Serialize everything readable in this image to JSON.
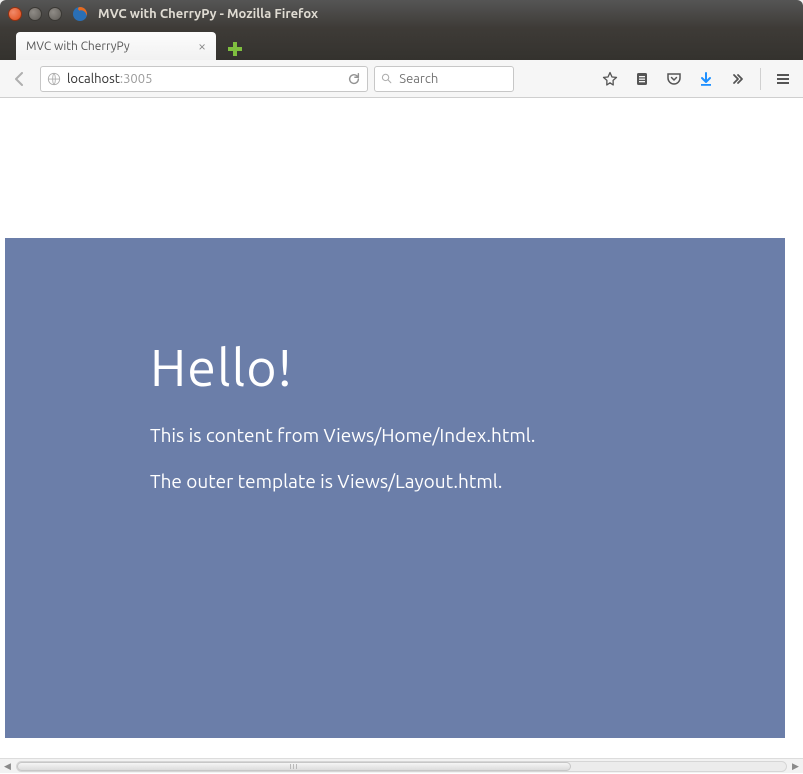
{
  "window": {
    "title": "MVC with CherryPy - Mozilla Firefox"
  },
  "tabs": [
    {
      "label": "MVC with CherryPy"
    }
  ],
  "address": {
    "host": "localhost",
    "port": ":3005"
  },
  "search": {
    "placeholder": "Search"
  },
  "page": {
    "heading": "Hello!",
    "line1": "This is content from Views/Home/Index.html.",
    "line2": "The outer template is Views/Layout.html."
  }
}
